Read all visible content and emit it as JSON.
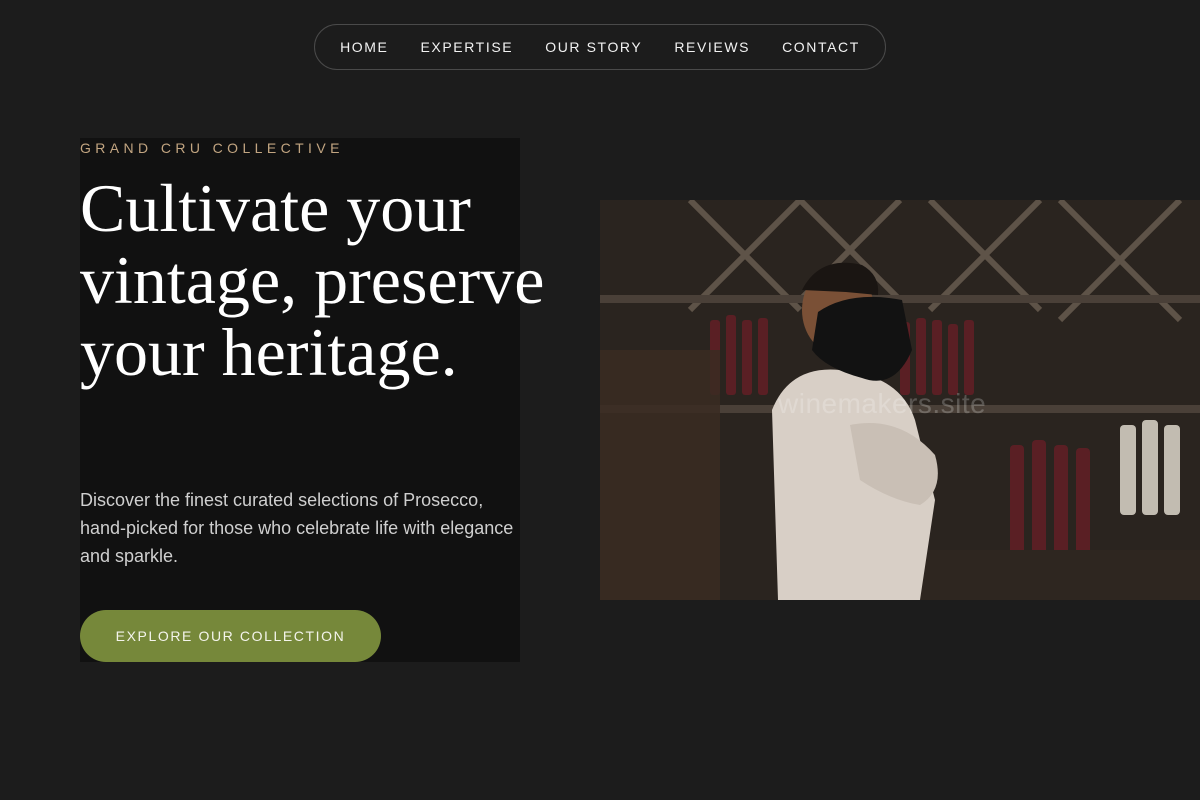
{
  "nav": {
    "items": [
      "HOME",
      "EXPERTISE",
      "OUR STORY",
      "REVIEWS",
      "CONTACT"
    ]
  },
  "hero": {
    "eyebrow": "GRAND CRU COLLECTIVE",
    "headline": "Cultivate your vintage, preserve your heritage.",
    "description": "Discover the finest curated selections of Prosecco, hand-picked for those who celebrate life with elegance and sparkle.",
    "cta_label": "EXPLORE OUR COLLECTION"
  },
  "image": {
    "watermark": "winemakers.site"
  },
  "colors": {
    "background": "#1c1c1c",
    "panel": "#111111",
    "accent": "#76883a",
    "eyebrow": "#c2a581"
  },
  "icons": []
}
